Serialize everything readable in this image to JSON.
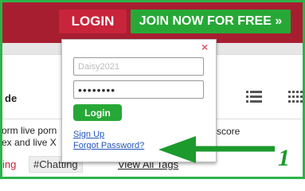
{
  "header": {
    "login_label": "LOGIN",
    "join_label": "JOIN NOW FOR FREE »"
  },
  "toolbar": {
    "label": "de",
    "list_icon": "list-view-icon",
    "grid_icon": "grid-view-icon"
  },
  "description": {
    "line1": "orm live porn",
    "line2": "ex and live X",
    "score": "score"
  },
  "tags": {
    "tag1": "ing",
    "tag2": "#Chatting",
    "view_all": "View All Tags"
  },
  "login_popup": {
    "close": "×",
    "username_value": "Daisy2021",
    "password_value": "••••••••",
    "login_button": "Login",
    "sign_up_link": "Sign Up",
    "forgot_password_link": "Forgot Password?"
  },
  "annotation": {
    "number": "1",
    "color": "#1c9a2c"
  },
  "colors": {
    "header_red": "#a81e31",
    "login_red": "#c8243b",
    "join_green": "#27a836",
    "frame_green": "#2db34a"
  }
}
